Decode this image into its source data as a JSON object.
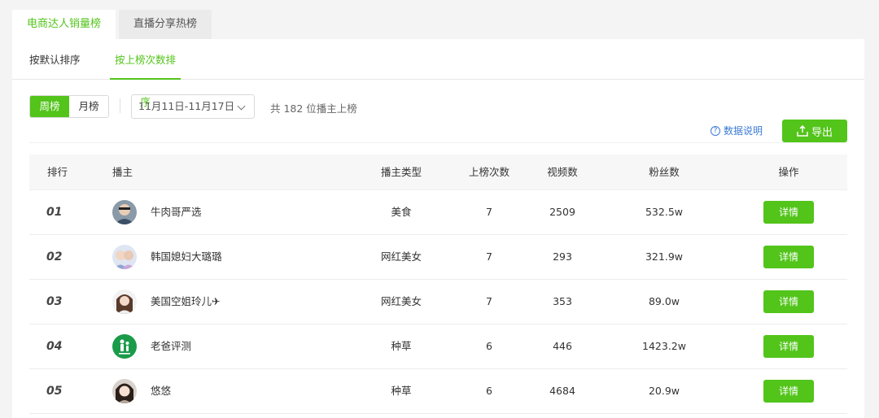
{
  "top_tabs": [
    {
      "label": "电商达人销量榜"
    },
    {
      "label": "直播分享热榜"
    }
  ],
  "sub_tabs": [
    {
      "label": "按默认排序"
    },
    {
      "label": "按上榜次数排序"
    }
  ],
  "period_toggle": {
    "week": "周榜",
    "month": "月榜"
  },
  "date_range": {
    "value": "11月11日-11月17日"
  },
  "summary": {
    "text": "共 182 位播主上榜"
  },
  "explain": {
    "icon": "question-circle-icon",
    "label": "数据说明"
  },
  "export": {
    "icon": "upload-icon",
    "label": "导出"
  },
  "accent_color": "#52c41a",
  "link_color": "#3a7bd5",
  "table": {
    "headers": {
      "rank": "排行",
      "streamer": "播主",
      "type": "播主类型",
      "times": "上榜次数",
      "videos": "视频数",
      "fans": "粉丝数",
      "action": "操作"
    },
    "rows": [
      {
        "rank": "01",
        "name": "牛肉哥严选",
        "type": "美食",
        "times": "7",
        "videos": "2509",
        "fans": "532.5w",
        "action": "详情"
      },
      {
        "rank": "02",
        "name": "韩国媳妇大璐璐",
        "type": "网红美女",
        "times": "7",
        "videos": "293",
        "fans": "321.9w",
        "action": "详情"
      },
      {
        "rank": "03",
        "name": "美国空姐玲儿✈",
        "type": "网红美女",
        "times": "7",
        "videos": "353",
        "fans": "89.0w",
        "action": "详情"
      },
      {
        "rank": "04",
        "name": "老爸评测",
        "type": "种草",
        "times": "6",
        "videos": "446",
        "fans": "1423.2w",
        "action": "详情"
      },
      {
        "rank": "05",
        "name": "悠悠",
        "type": "种草",
        "times": "6",
        "videos": "4684",
        "fans": "20.9w",
        "action": "详情"
      }
    ]
  }
}
